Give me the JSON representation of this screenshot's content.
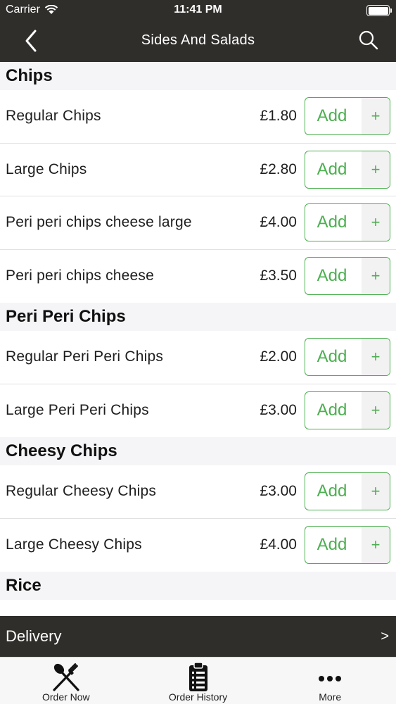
{
  "status_bar": {
    "carrier": "Carrier",
    "time": "11:41 PM"
  },
  "nav": {
    "title": "Sides And Salads",
    "back_icon": "chevron-left-icon",
    "search_icon": "search-icon"
  },
  "sections": [
    {
      "title": "Chips",
      "items": [
        {
          "name": "Regular Chips",
          "price": "£1.80",
          "add_label": "Add",
          "plus": "+"
        },
        {
          "name": "Large Chips",
          "price": "£2.80",
          "add_label": "Add",
          "plus": "+"
        },
        {
          "name": "Peri peri chips cheese large",
          "price": "£4.00",
          "add_label": "Add",
          "plus": "+"
        },
        {
          "name": "Peri peri chips cheese",
          "price": "£3.50",
          "add_label": "Add",
          "plus": "+"
        }
      ]
    },
    {
      "title": "Peri Peri Chips",
      "items": [
        {
          "name": "Regular Peri Peri Chips",
          "price": "£2.00",
          "add_label": "Add",
          "plus": "+"
        },
        {
          "name": "Large Peri Peri Chips",
          "price": "£3.00",
          "add_label": "Add",
          "plus": "+"
        }
      ]
    },
    {
      "title": "Cheesy Chips",
      "items": [
        {
          "name": "Regular Cheesy Chips",
          "price": "£3.00",
          "add_label": "Add",
          "plus": "+"
        },
        {
          "name": "Large Cheesy Chips",
          "price": "£4.00",
          "add_label": "Add",
          "plus": "+"
        }
      ]
    },
    {
      "title": "Rice",
      "items": []
    }
  ],
  "delivery": {
    "label": "Delivery",
    "chevron": ">"
  },
  "tabs": [
    {
      "label": "Order Now",
      "icon": "fork-spoon-icon"
    },
    {
      "label": "Order History",
      "icon": "clipboard-list-icon"
    },
    {
      "label": "More",
      "icon": "more-dots-icon"
    }
  ],
  "colors": {
    "header_bg": "#302e2b",
    "accent_green": "#4caf50",
    "section_bg": "#f5f5f7"
  }
}
